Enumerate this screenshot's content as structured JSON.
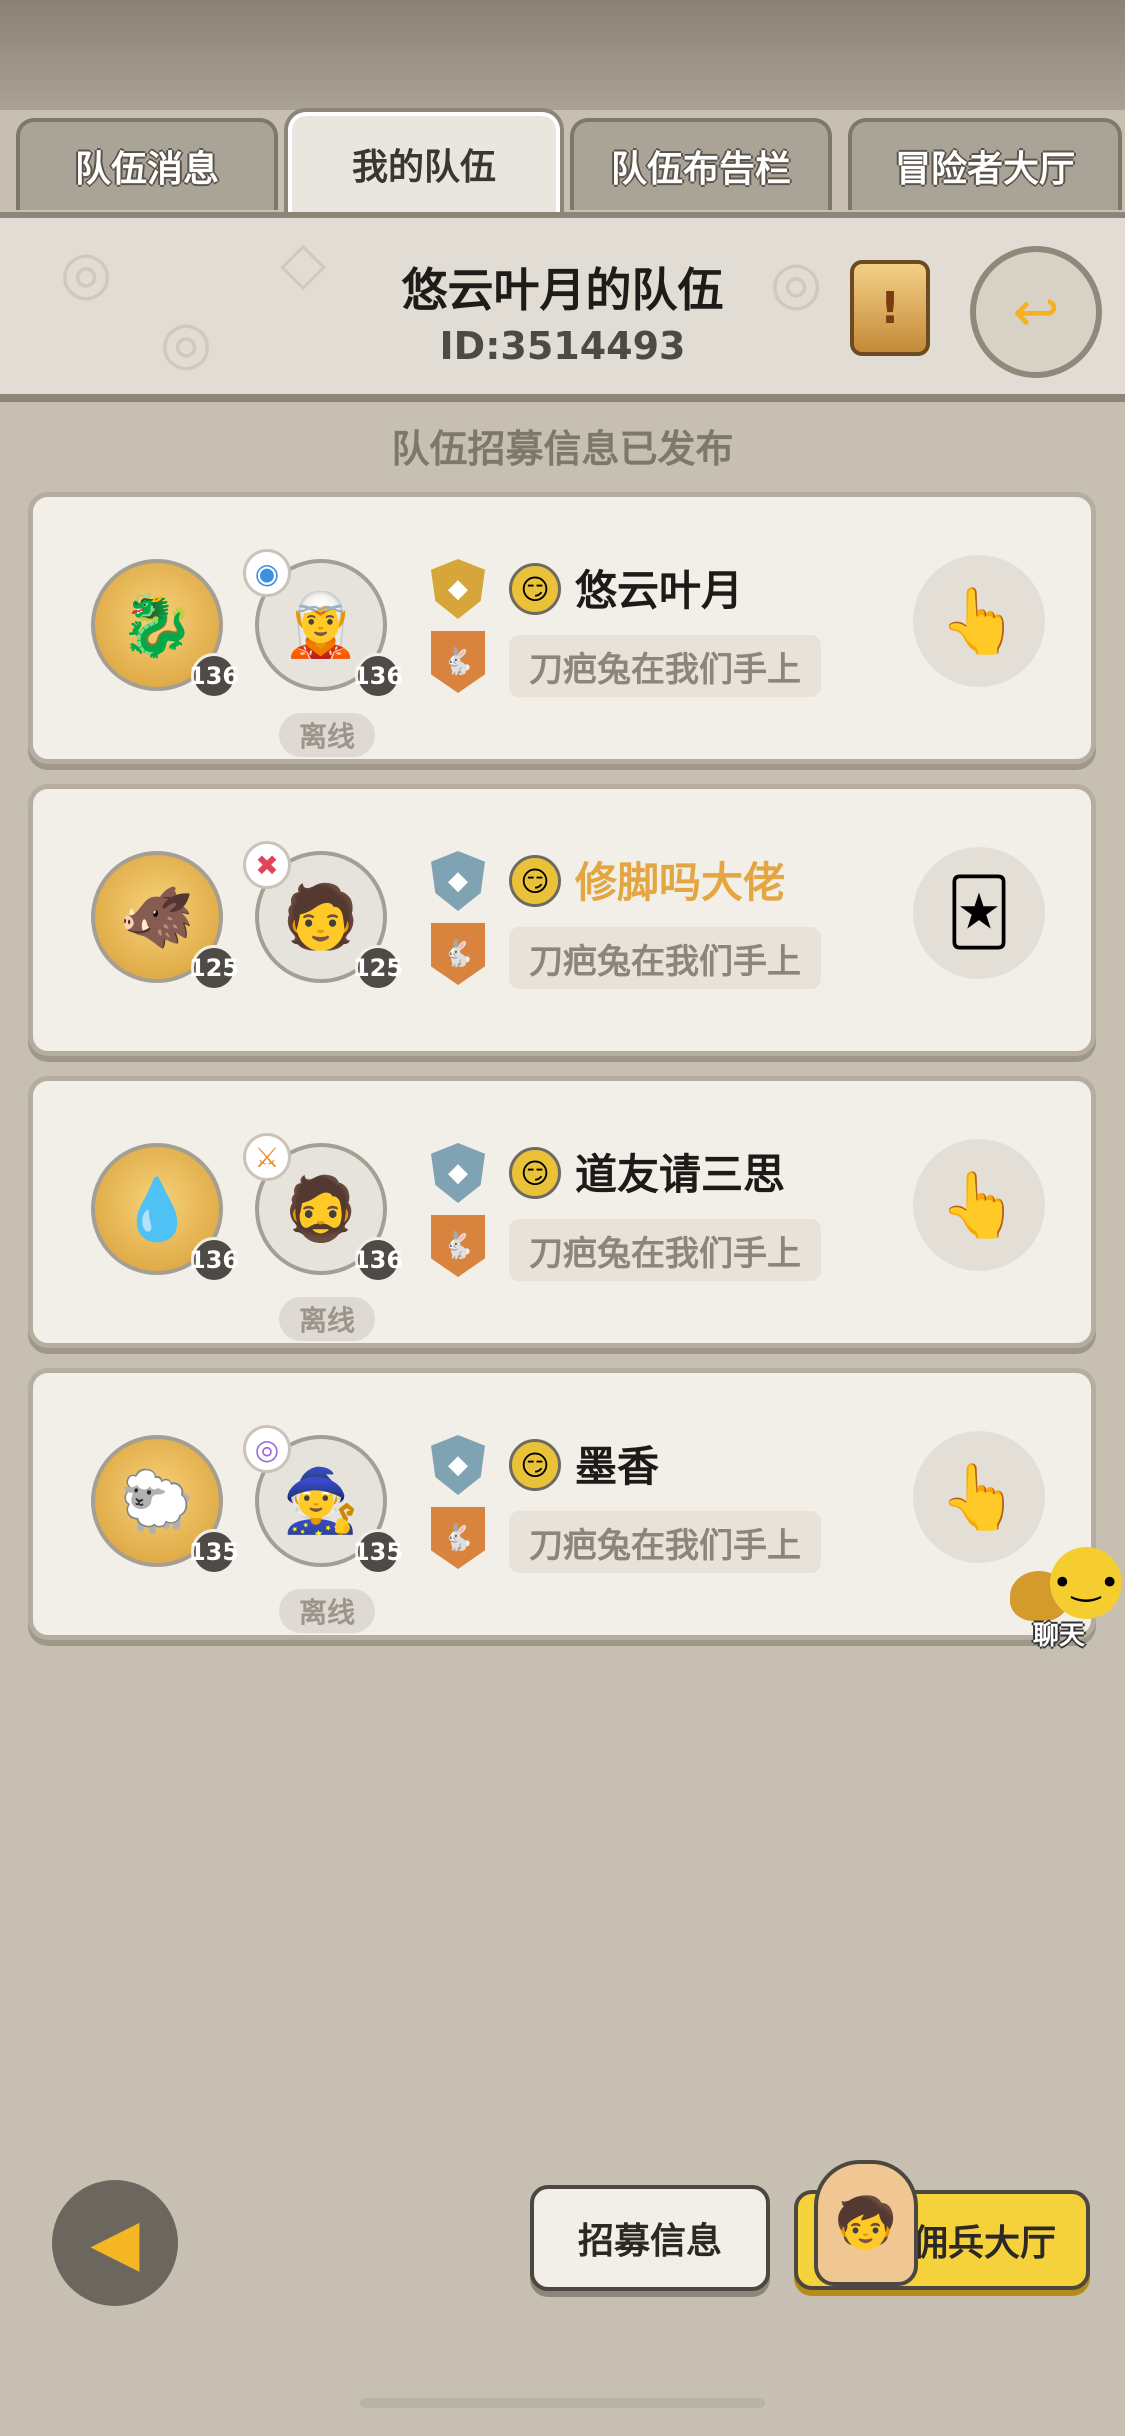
{
  "tabs": [
    {
      "label": "队伍消息",
      "active": false
    },
    {
      "label": "我的队伍",
      "active": true
    },
    {
      "label": "队伍布告栏",
      "active": false
    },
    {
      "label": "冒险者大厅",
      "active": false
    }
  ],
  "team": {
    "title": "悠云叶月的队伍",
    "id": "ID:3514493"
  },
  "notice": "队伍招募信息已发布",
  "members": [
    {
      "name": "悠云叶月",
      "name_color": "#1d1b18",
      "pet_level": "136",
      "hero_level": "136",
      "status": "离线",
      "boss": "刀疤兔在我们手上",
      "shield_color": "#d7a63a",
      "class_icon": "blue-swirl-icon"
    },
    {
      "name": "修脚吗大佬",
      "name_color": "#e3a640",
      "pet_level": "125",
      "hero_level": "125",
      "status": "",
      "boss": "刀疤兔在我们手上",
      "shield_color": "#7fa3b3",
      "class_icon": "red-cross-icon"
    },
    {
      "name": "道友请三思",
      "name_color": "#1d1b18",
      "pet_level": "136",
      "hero_level": "136",
      "status": "离线",
      "boss": "刀疤兔在我们手上",
      "shield_color": "#7fa3b3",
      "class_icon": "orange-sword-icon"
    },
    {
      "name": "墨香",
      "name_color": "#1d1b18",
      "pet_level": "135",
      "hero_level": "135",
      "status": "离线",
      "boss": "刀疤兔在我们手上",
      "shield_color": "#7fa3b3",
      "class_icon": "purple-swirl-icon"
    }
  ],
  "chat": {
    "label": "聊天"
  },
  "bottom": {
    "recruit_label": "招募信息",
    "merc_label": "佣兵大厅"
  }
}
